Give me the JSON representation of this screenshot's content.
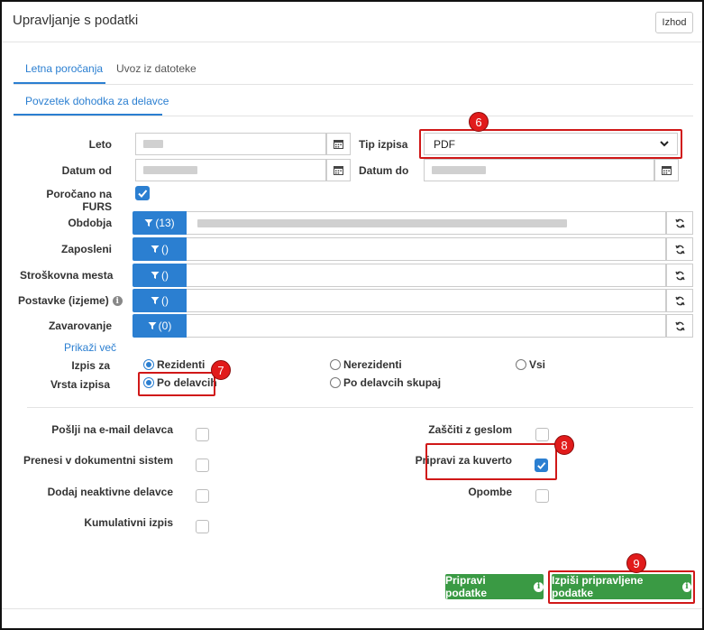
{
  "header": {
    "title": "Upravljanje s podatki",
    "exit_label": "Izhod"
  },
  "tabs": [
    {
      "label": "Letna poročanja",
      "active": true
    },
    {
      "label": "Uvoz iz datoteke",
      "active": false
    }
  ],
  "subtab": {
    "label": "Povzetek dohodka za delavce"
  },
  "form": {
    "leto_label": "Leto",
    "tip_izpisa_label": "Tip izpisa",
    "tip_izpisa_value": "PDF",
    "datum_od_label": "Datum od",
    "datum_do_label": "Datum do",
    "porocano_label": "Poročano na FURS",
    "porocano_checked": true
  },
  "filters": [
    {
      "label": "Obdobja",
      "button": "(13)"
    },
    {
      "label": "Zaposleni",
      "button": "()"
    },
    {
      "label": "Stroškovna mesta",
      "button": "()"
    },
    {
      "label": "Postavke (izjeme)",
      "button": "()"
    },
    {
      "label": "Zavarovanje",
      "button": "(0)"
    }
  ],
  "show_more": "Prikaži več",
  "izpis_za": {
    "label": "Izpis za",
    "options": [
      "Rezidenti",
      "Nerezidenti",
      "Vsi"
    ],
    "selected": "Rezidenti"
  },
  "vrsta_izpisa": {
    "label": "Vrsta izpisa",
    "options": [
      "Po delavcih",
      "Po delavcih skupaj"
    ],
    "selected": "Po delavcih"
  },
  "options_left": [
    {
      "label": "Pošlji na e-mail delavca",
      "checked": false
    },
    {
      "label": "Prenesi v dokumentni sistem",
      "checked": false
    },
    {
      "label": "Dodaj neaktivne delavce",
      "checked": false
    },
    {
      "label": "Kumulativni izpis",
      "checked": false
    }
  ],
  "options_right": [
    {
      "label": "Zaščiti z geslom",
      "checked": false
    },
    {
      "label": "Pripravi za kuverto",
      "checked": true
    },
    {
      "label": "Opombe",
      "checked": false
    }
  ],
  "buttons": {
    "prepare": "Pripravi podatke",
    "print": "Izpiši pripravljene podatke"
  },
  "callouts": [
    "6",
    "7",
    "8",
    "9"
  ],
  "colors": {
    "accent": "#2b7fd1",
    "success": "#3a9a44",
    "callout": "#e11b1b"
  },
  "icons": [
    "calendar-icon",
    "chevron-down-icon",
    "filter-icon",
    "refresh-icon",
    "info-icon",
    "check-icon"
  ]
}
